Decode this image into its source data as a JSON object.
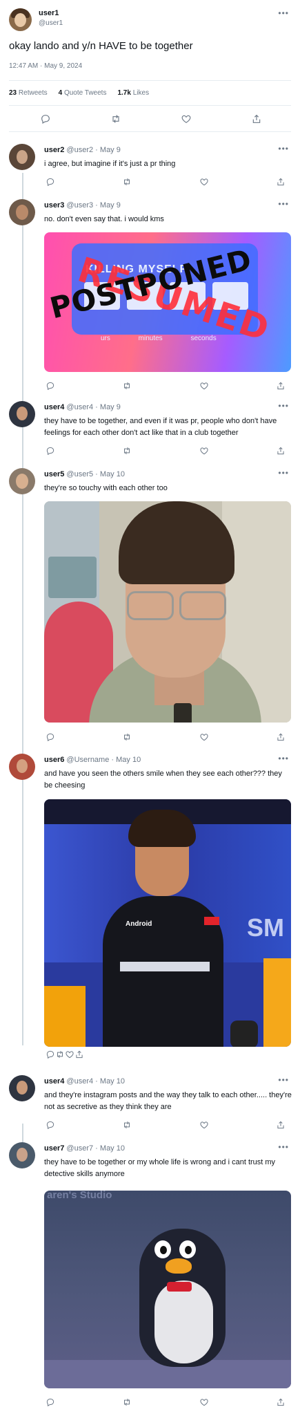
{
  "main_tweet": {
    "author_name": "user1",
    "author_handle": "@user1",
    "more": "•••",
    "text": "okay lando and y/n HAVE to be together",
    "timestamp": "12:47 AM · May 9, 2024",
    "stats": {
      "retweets_count": "23",
      "retweets_label": "Retweets",
      "quotes_count": "4",
      "quotes_label": "Quote Tweets",
      "likes_count": "1.7k",
      "likes_label": "Likes"
    }
  },
  "replies": [
    {
      "name": "user2",
      "handle": "@user2",
      "sep": "·",
      "date": "May 9",
      "more": "•••",
      "text": "i agree, but imagine if it's just a pr thing"
    },
    {
      "name": "user3",
      "handle": "@user3",
      "sep": "·",
      "date": "May 9",
      "more": "•••",
      "text": "no. don't even say that. i would kms",
      "media": {
        "caption_top": "KILLING MYSELF",
        "stamp_red": "RESUMED",
        "stamp_black": "POSTPONED",
        "units": "urs minutes seconds"
      }
    },
    {
      "name": "user4",
      "handle": "@user4",
      "sep": "·",
      "date": "May 9",
      "more": "•••",
      "text": "they have to be together, and even if it was pr, people who don't have feelings for each other don't act like that in a club together"
    },
    {
      "name": "user5",
      "handle": "@user5",
      "sep": "·",
      "date": "May 10",
      "more": "•••",
      "text": "they're so touchy with each other too"
    },
    {
      "name": "user6",
      "handle": "@Username",
      "sep": "·",
      "date": "May 10",
      "more": "•••",
      "text": "and have you seen the others smile when they see each other??? they be cheesing",
      "media": {
        "sponsor": "Android",
        "bg_text": "SM"
      }
    },
    {
      "name": "user4",
      "handle": "@user4",
      "sep": "·",
      "date": "May 10",
      "more": "•••",
      "text": "and they're instagram posts and the way they talk to each other..... they're not as secretive as they think they are"
    },
    {
      "name": "user7",
      "handle": "@user7",
      "sep": "·",
      "date": "May 10",
      "more": "•••",
      "text": "they have to be together or my whole life is wrong and i cant trust my detective skills anymore",
      "media": {
        "bg_text": "aren's Studio"
      }
    }
  ],
  "icons": [
    "reply-icon",
    "retweet-icon",
    "like-icon",
    "share-icon"
  ],
  "colors": {
    "text": "#0f1419",
    "muted": "#6b7785",
    "line": "#cfd9de",
    "divider": "#e6ecf0"
  }
}
